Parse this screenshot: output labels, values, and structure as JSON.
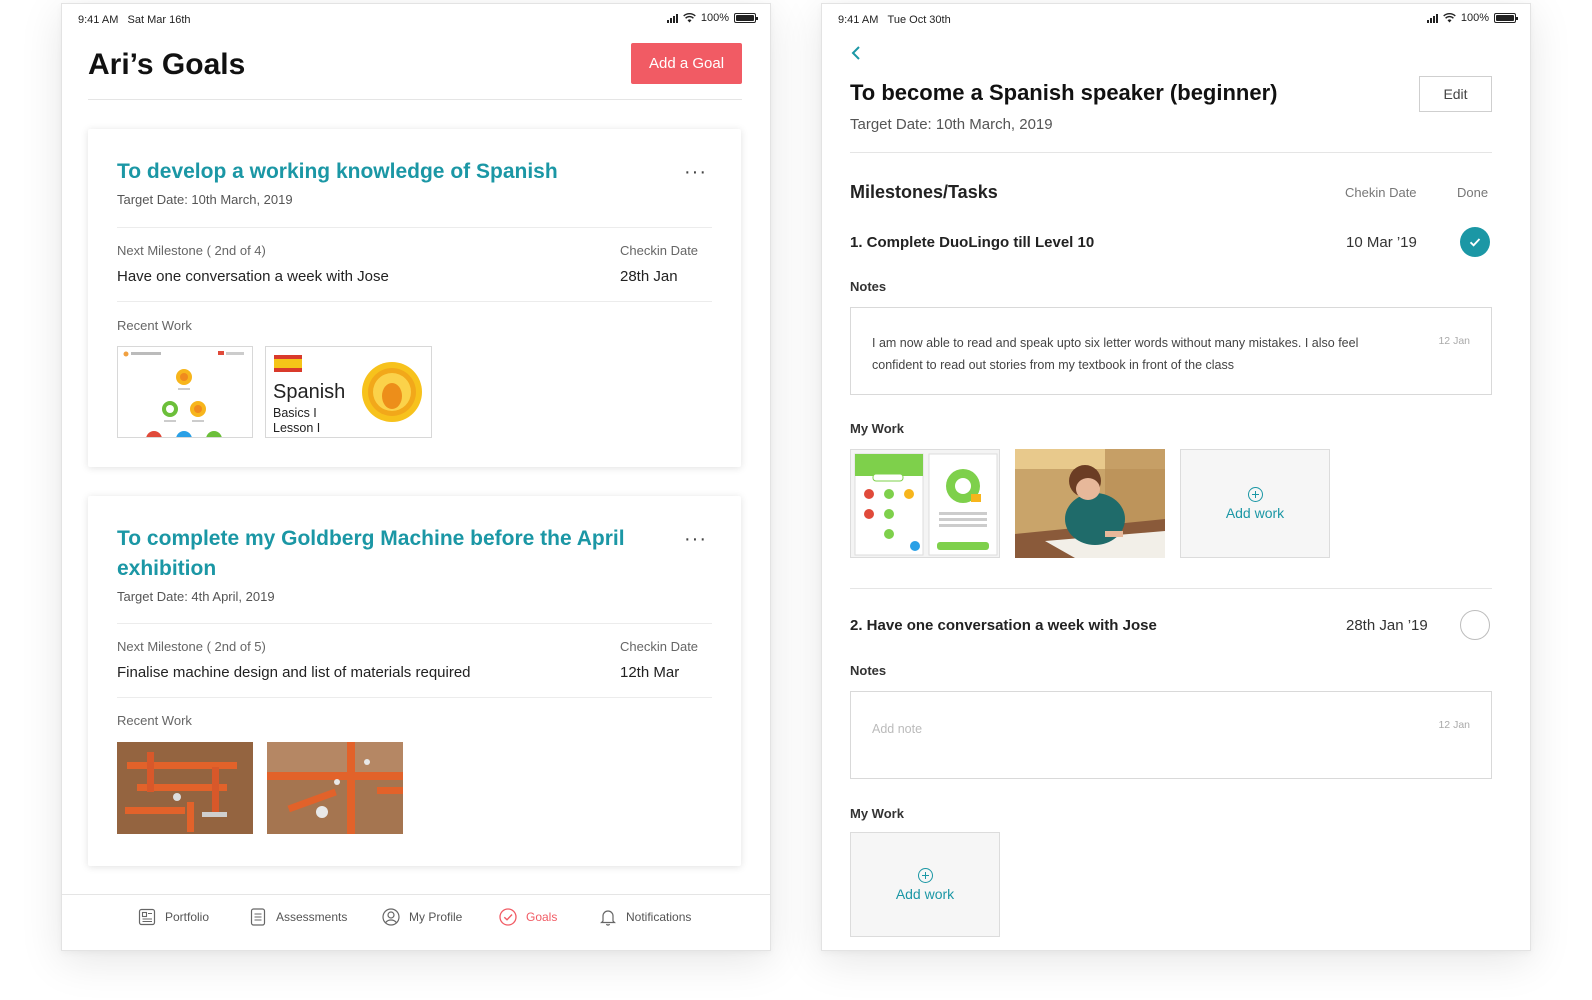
{
  "left": {
    "status": {
      "time": "9:41 AM",
      "date": "Sat Mar 16th",
      "battery": "100%"
    },
    "title": "Ari’s Goals",
    "add_goal_label": "Add a Goal",
    "goals": [
      {
        "title": "To develop a working knowledge of Spanish",
        "target_date": "Target Date: 10th March, 2019",
        "next_milestone_label": "Next Milestone ( 2nd of 4)",
        "milestone": "Have one conversation a week with Jose",
        "checkin_label": "Checkin Date",
        "checkin_value": "28th Jan",
        "recent_work_label": "Recent Work",
        "thumb2_title": "Spanish",
        "thumb2_sub1": "Basics I",
        "thumb2_sub2": "Lesson I"
      },
      {
        "title": "To complete my Goldberg Machine before the April exhibition",
        "target_date": "Target Date: 4th April, 2019",
        "next_milestone_label": "Next Milestone ( 2nd of 5)",
        "milestone": "Finalise machine design and list of materials required",
        "checkin_label": "Checkin Date",
        "checkin_value": "12th Mar",
        "recent_work_label": "Recent Work"
      }
    ],
    "more_glyph": "···",
    "tabs": [
      {
        "label": "Portfolio",
        "icon": "portfolio-icon"
      },
      {
        "label": "Assessments",
        "icon": "assessments-icon"
      },
      {
        "label": "My Profile",
        "icon": "profile-icon"
      },
      {
        "label": "Goals",
        "icon": "goals-icon",
        "active": true
      },
      {
        "label": "Notifications",
        "icon": "bell-icon"
      }
    ]
  },
  "right": {
    "status": {
      "time": "9:41 AM",
      "date": "Tue Oct 30th",
      "battery": "100%"
    },
    "title": "To become a Spanish speaker (beginner)",
    "edit_label": "Edit",
    "target_date": "Target Date: 10th March, 2019",
    "section_heading": "Milestones/Tasks",
    "col_checkin": "Chekin Date",
    "col_done": "Done",
    "tasks": [
      {
        "title": "1.  Complete DuoLingo till Level 10",
        "date": "10 Mar ’19",
        "done": true,
        "notes_label": "Notes",
        "note": "I am now able to read and speak upto six letter words without many mistakes. I also feel confident to read out stories from my textbook in front of the class",
        "note_date": "12 Jan",
        "my_work_label": "My Work",
        "add_work_label": "Add work"
      },
      {
        "title": "2.  Have one conversation a week with Jose",
        "date": "28th Jan ’19",
        "done": false,
        "notes_label": "Notes",
        "note_placeholder": "Add note",
        "note_date": "12 Jan",
        "my_work_label": "My Work",
        "add_work_label": "Add work"
      }
    ]
  },
  "colors": {
    "accent": "#1b97a5",
    "primary_button": "#f15b64"
  }
}
